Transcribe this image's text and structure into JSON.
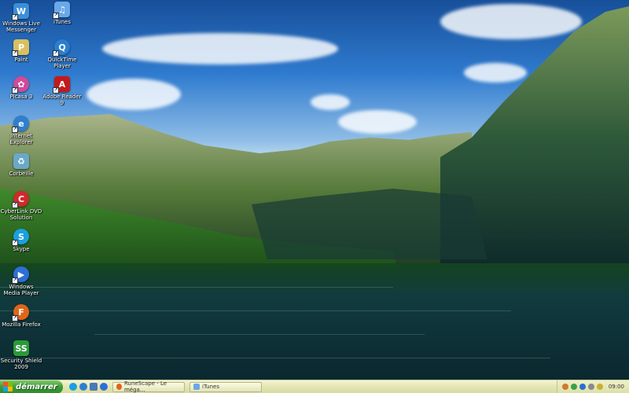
{
  "desktop": {
    "icons_left": [
      {
        "label": "Windows Live Messenger",
        "icon": "messenger-icon",
        "color": "#3a8fd6"
      },
      {
        "label": "Paint",
        "icon": "paint-icon",
        "color": "#d8c060"
      },
      {
        "label": "Picasa 3",
        "icon": "picasa-icon",
        "color": "#d04a9a"
      },
      {
        "label": "Internet Explorer",
        "icon": "internet-explorer-icon",
        "color": "#2f7fd0"
      },
      {
        "label": "Corbeille",
        "icon": "recycle-bin-icon",
        "color": "#6aa8c8"
      },
      {
        "label": "CyberLink DVD Solution",
        "icon": "cyberlink-icon",
        "color": "#d02a2a"
      },
      {
        "label": "Skype",
        "icon": "skype-icon",
        "color": "#1aa0e0"
      },
      {
        "label": "Windows Media Player",
        "icon": "media-player-icon",
        "color": "#2d6fd6"
      },
      {
        "label": "Mozilla Firefox",
        "icon": "firefox-icon",
        "color": "#e0651a"
      },
      {
        "label": "Security Shield 2009",
        "icon": "security-shield-icon",
        "color": "#2a9a3a"
      }
    ],
    "icons_right": [
      {
        "label": "iTunes",
        "icon": "itunes-icon",
        "color": "#6aa8e8"
      },
      {
        "label": "QuickTime Player",
        "icon": "quicktime-icon",
        "color": "#2a7fd0"
      },
      {
        "label": "Adobe Reader 9",
        "icon": "adobe-reader-icon",
        "color": "#c41a1a"
      }
    ]
  },
  "taskbar": {
    "start_label": "démarrer",
    "tasks": [
      {
        "label": "RuneScape - Le méga...",
        "icon": "firefox-icon",
        "color": "#e0651a"
      },
      {
        "label": "iTunes",
        "icon": "itunes-icon",
        "color": "#6aa8e8"
      }
    ],
    "clock": "09:00"
  }
}
